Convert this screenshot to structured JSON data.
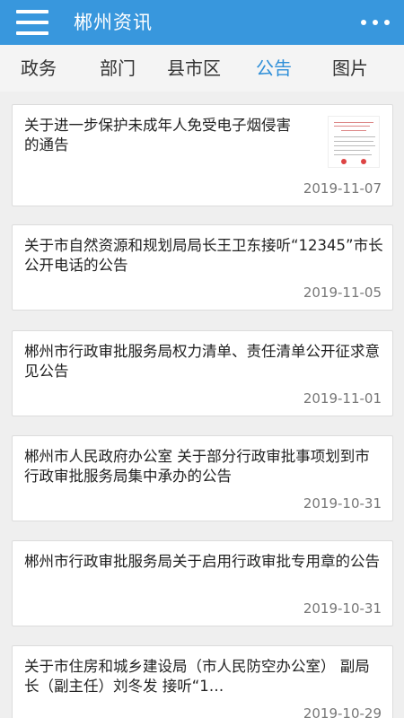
{
  "header": {
    "title": "郴州资讯",
    "menu_icon": "hamburger-menu-icon",
    "more_icon": "more-dots-icon",
    "bar_color": "#3897dd"
  },
  "tabs": [
    {
      "label": "政务",
      "active": false
    },
    {
      "label": "部门",
      "active": false
    },
    {
      "label": "县市区",
      "active": false
    },
    {
      "label": "公告",
      "active": true
    },
    {
      "label": "图片",
      "active": false
    }
  ],
  "accent_color": "#2f8fd8",
  "articles": [
    {
      "title": "关于进一步保护未成年人免受电子烟侵害的通告",
      "date": "2019-11-07",
      "has_thumbnail": true
    },
    {
      "title": "关于市自然资源和规划局局长王卫东接听“12345”市长公开电话的公告",
      "date": "2019-11-05",
      "has_thumbnail": false
    },
    {
      "title": "郴州市行政审批服务局权力清单、责任清单公开征求意见公告",
      "date": "2019-11-01",
      "has_thumbnail": false
    },
    {
      "title": " 郴州市人民政府办公室 关于部分行政审批事项划到市行政审批服务局集中承办的公告",
      "date": "2019-10-31",
      "has_thumbnail": false
    },
    {
      "title": "郴州市行政审批服务局关于启用行政审批专用章的公告",
      "date": "2019-10-31",
      "has_thumbnail": false
    },
    {
      "title": "关于市住房和城乡建设局（市人民防空办公室） 副局长（副主任）刘冬发 接听“1…",
      "date": "2019-10-29",
      "has_thumbnail": false
    }
  ]
}
